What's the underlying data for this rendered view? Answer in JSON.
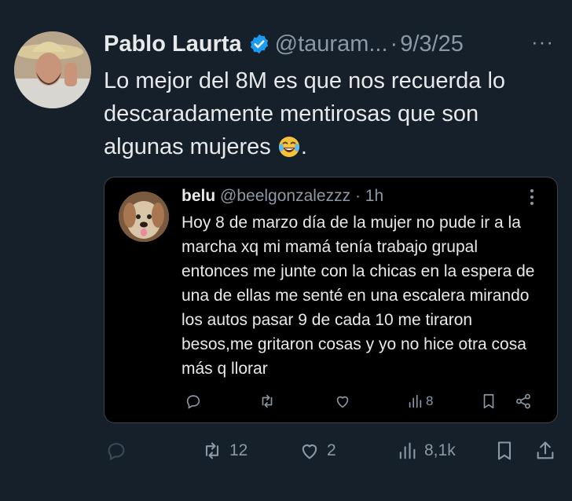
{
  "tweet": {
    "author_name": "Pablo Laurta",
    "handle": "@tauram...",
    "separator": "·",
    "date": "9/3/25",
    "more": "···",
    "text": "Lo mejor del 8M es que nos recuerda lo descaradamente mentirosas que son algunas mujeres",
    "text_end": ".",
    "emoji": "face-with-tears-of-joy"
  },
  "quote": {
    "author_name": "belu",
    "handle": "@beelgonzalezzz",
    "separator": "·",
    "time": "1h",
    "text": "Hoy 8 de marzo día de la mujer no pude ir a la marcha xq mi mamá tenía trabajo grupal entonces me junte con la chicas en la espera de una de ellas me senté en una escalera mirando los autos pasar 9 de cada 10 me tiraron besos,me gritaron cosas y yo no hice otra cosa más q llorar",
    "views": "8"
  },
  "actions": {
    "retweets": "12",
    "likes": "2",
    "views": "8,1k"
  },
  "colors": {
    "background": "#15202b",
    "verified": "#1d9bf0",
    "muted": "#8b98a5",
    "text": "#e7e9ea"
  }
}
